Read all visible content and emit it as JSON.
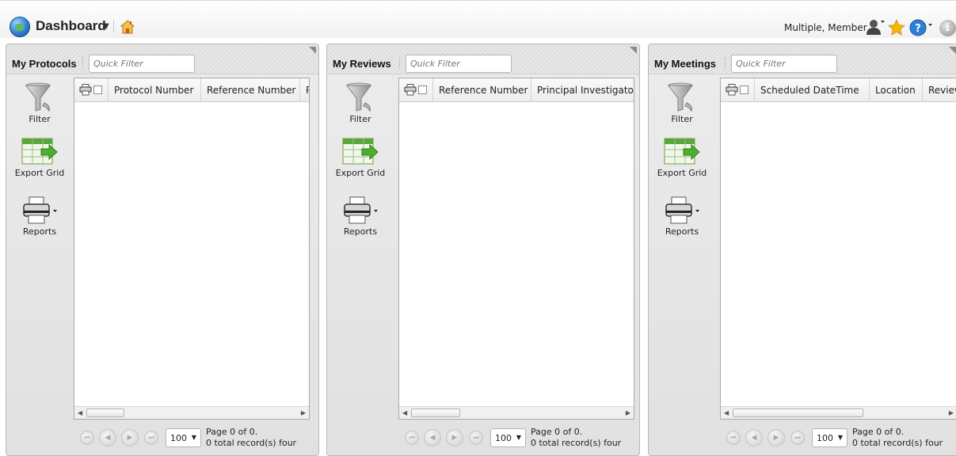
{
  "header": {
    "title": "Dashboard",
    "user_name": "Multiple, Member"
  },
  "panels": [
    {
      "title": "My Protocols",
      "quick_filter_placeholder": "Quick Filter",
      "tools": {
        "filter": "Filter",
        "export": "Export Grid",
        "reports": "Reports"
      },
      "columns": [
        "Protocol Number",
        "Reference Number",
        "P"
      ],
      "pager": {
        "page_size": "100",
        "page_info": "Page 0 of 0.",
        "records": "0 total record(s) four"
      }
    },
    {
      "title": "My Reviews",
      "quick_filter_placeholder": "Quick Filter",
      "tools": {
        "filter": "Filter",
        "export": "Export Grid",
        "reports": "Reports"
      },
      "columns": [
        "Reference Number",
        "Principal Investigator"
      ],
      "pager": {
        "page_size": "100",
        "page_info": "Page 0 of 0.",
        "records": "0 total record(s) four"
      }
    },
    {
      "title": "My Meetings",
      "quick_filter_placeholder": "Quick Filter",
      "tools": {
        "filter": "Filter",
        "export": "Export Grid",
        "reports": "Reports"
      },
      "columns": [
        "Scheduled DateTime",
        "Location",
        "Review"
      ],
      "pager": {
        "page_size": "100",
        "page_info": "Page 0 of 0.",
        "records": "0 total record(s) four"
      }
    }
  ],
  "colors": {
    "accent_blue": "#2e7fd6",
    "export_green": "#5aa83c",
    "star_yellow": "#f5b800"
  },
  "icons": [
    "globe-icon",
    "home-icon",
    "user-icon",
    "star-icon",
    "help-icon",
    "info-icon",
    "filter-icon",
    "export-grid-icon",
    "printer-icon"
  ]
}
